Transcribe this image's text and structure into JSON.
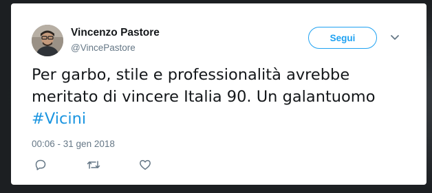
{
  "tweet": {
    "author": {
      "name": "Vincenzo Pastore",
      "handle": "@VincePastore"
    },
    "follow_label": "Segui",
    "text": "Per garbo, stile e professionalità avrebbe meritato di vincere Italia 90. Un galantuomo",
    "hashtag": "#Vicini",
    "timestamp": "00:06 - 31 gen 2018",
    "actions": [
      {
        "icon": "reply-icon"
      },
      {
        "icon": "retweet-icon"
      },
      {
        "icon": "like-icon"
      }
    ]
  },
  "colors": {
    "accent": "#1da1f2",
    "hashtag": "#1b95e0",
    "text": "#14171a",
    "secondary": "#657786"
  }
}
